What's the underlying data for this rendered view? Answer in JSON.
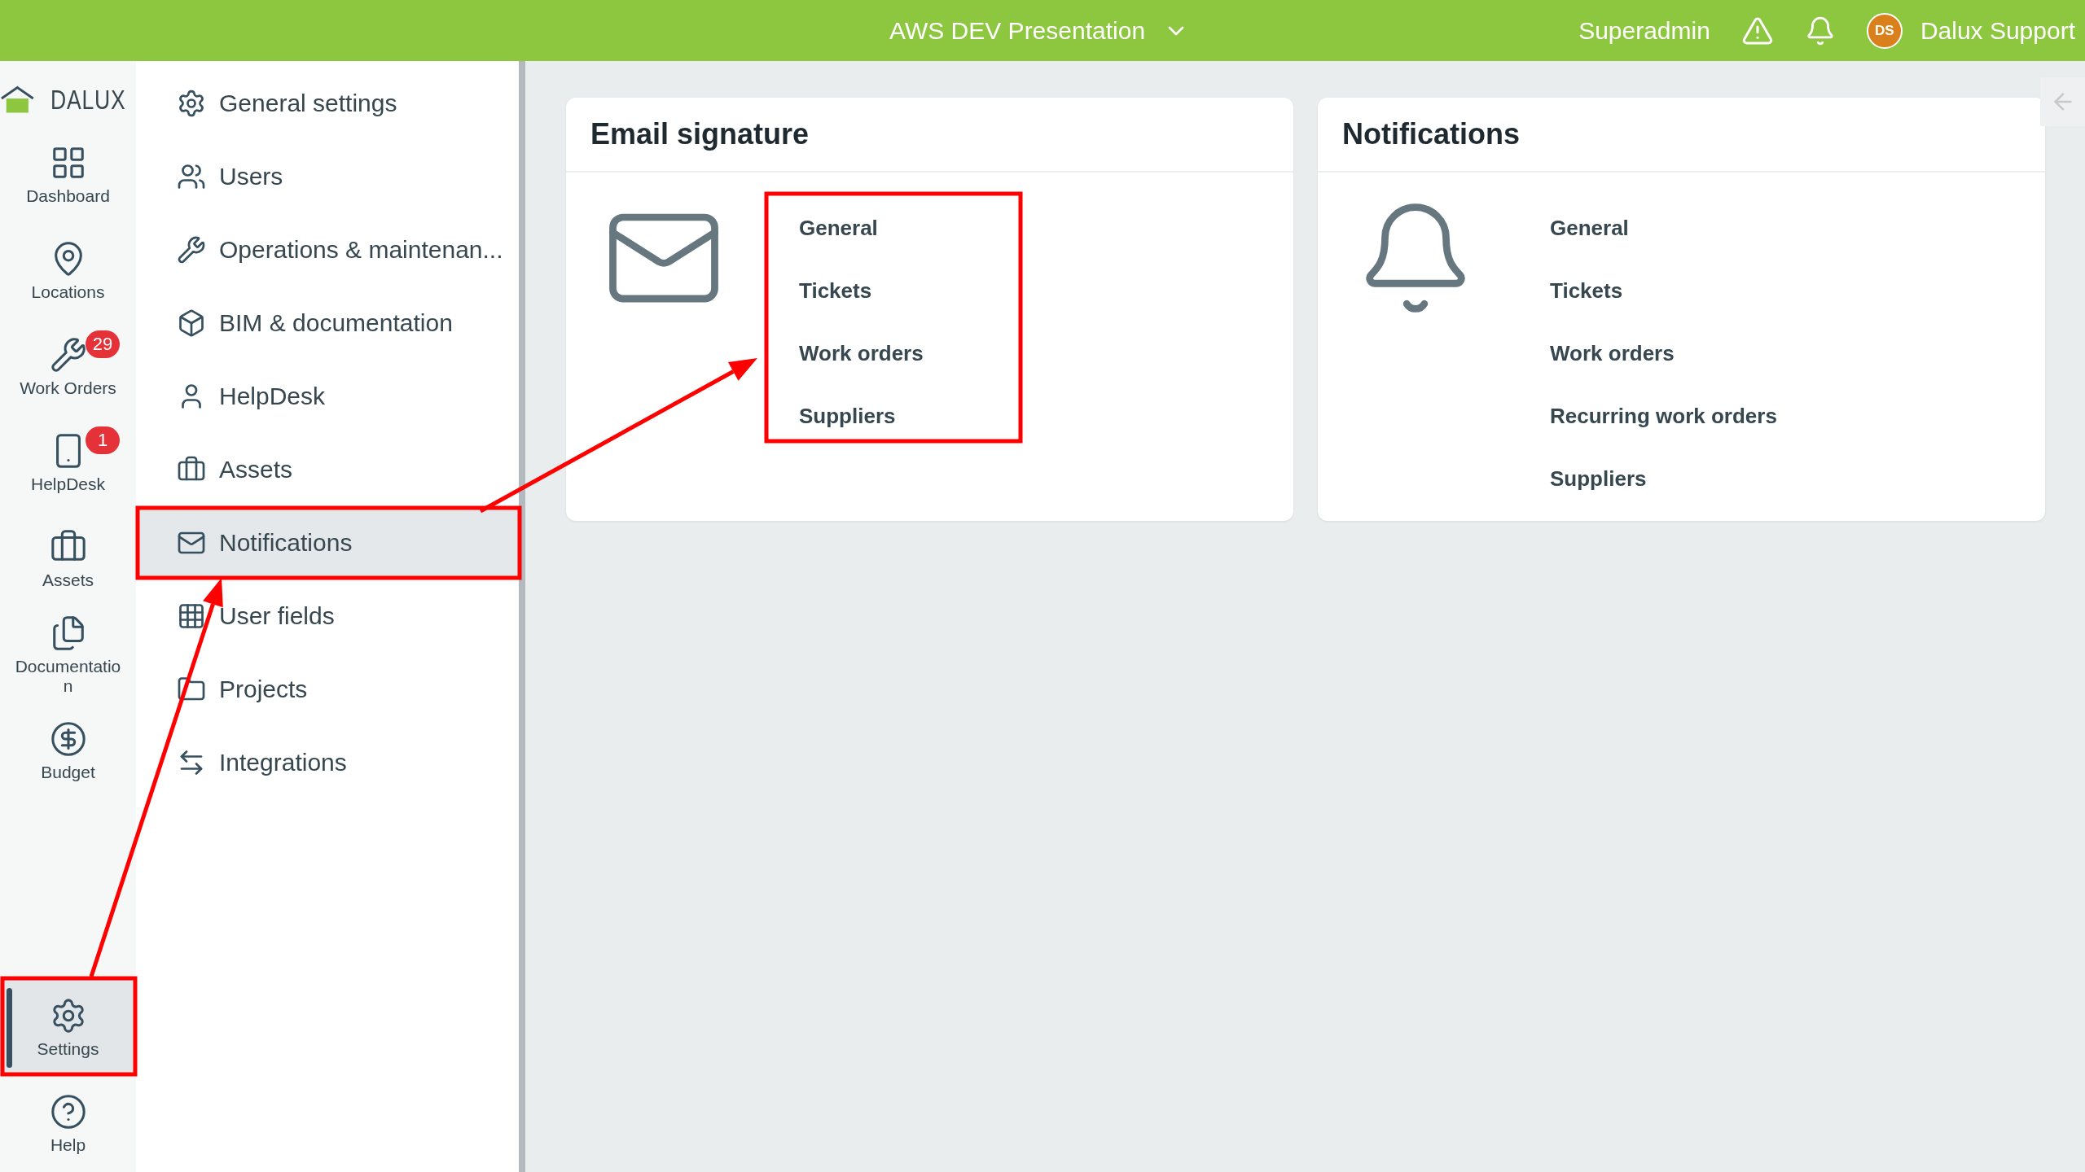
{
  "top_bar": {
    "project": "AWS DEV Presentation",
    "role": "Superadmin",
    "avatar_initials": "DS",
    "user": "Dalux Support"
  },
  "logo": {
    "text": "DALUX"
  },
  "nav_rail": [
    {
      "label": "Dashboard",
      "selected": false
    },
    {
      "label": "Locations",
      "selected": false
    },
    {
      "label": "Work Orders",
      "selected": false,
      "badge": "29"
    },
    {
      "label": "HelpDesk",
      "selected": false,
      "badge": "1"
    },
    {
      "label": "Assets",
      "selected": false
    },
    {
      "label": "Documentation",
      "selected": false
    },
    {
      "label": "Budget",
      "selected": false
    },
    {
      "label": "Settings",
      "selected": true
    },
    {
      "label": "Help",
      "selected": false
    }
  ],
  "settings_menu": [
    {
      "label": "General settings",
      "selected": false
    },
    {
      "label": "Users",
      "selected": false
    },
    {
      "label": "Operations & maintenan...",
      "selected": false
    },
    {
      "label": "BIM & documentation",
      "selected": false
    },
    {
      "label": "HelpDesk",
      "selected": false
    },
    {
      "label": "Assets",
      "selected": false
    },
    {
      "label": "Notifications",
      "selected": true
    },
    {
      "label": "User fields",
      "selected": false
    },
    {
      "label": "Projects",
      "selected": false
    },
    {
      "label": "Integrations",
      "selected": false
    }
  ],
  "cards": [
    {
      "title": "Email signature",
      "kind": "envelope",
      "links": [
        "General",
        "Tickets",
        "Work orders",
        "Suppliers"
      ]
    },
    {
      "title": "Notifications",
      "kind": "bell",
      "links": [
        "General",
        "Tickets",
        "Work orders",
        "Recurring work orders",
        "Suppliers"
      ]
    }
  ]
}
